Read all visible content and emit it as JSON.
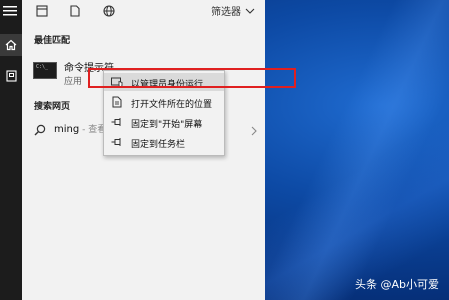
{
  "panel": {
    "filter_label": "筛选器",
    "best_match_title": "最佳匹配",
    "web_title": "搜索网页"
  },
  "best_match": {
    "name": "命令提示符",
    "type": "应用",
    "thumb_text": "C:\\_"
  },
  "web_search": {
    "query": "ming",
    "suffix": " - 查看"
  },
  "context_menu": {
    "items": [
      {
        "label": "以管理员身份运行",
        "icon": "shield-run-icon"
      },
      {
        "label": "打开文件所在的位置",
        "icon": "file-location-icon"
      },
      {
        "label": "固定到\"开始\"屏幕",
        "icon": "pin-icon"
      },
      {
        "label": "固定到任务栏",
        "icon": "pin-icon"
      }
    ]
  },
  "watermark": "头条 @Ab小可爱",
  "colors": {
    "highlight_box": "#e02020",
    "panel_bg": "#f2f2f2",
    "sidebar_bg": "#1c1c1c"
  }
}
